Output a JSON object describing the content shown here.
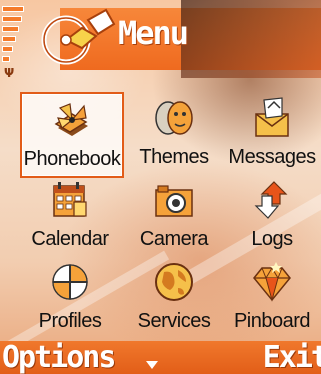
{
  "header": {
    "title": "Menu"
  },
  "grid": [
    {
      "label": "Phonebook",
      "icon": "phonebook-icon",
      "selected": true
    },
    {
      "label": "Themes",
      "icon": "themes-icon"
    },
    {
      "label": "Messages",
      "icon": "messages-icon"
    },
    {
      "label": "Calendar",
      "icon": "calendar-icon"
    },
    {
      "label": "Camera",
      "icon": "camera-icon"
    },
    {
      "label": "Logs",
      "icon": "logs-icon"
    },
    {
      "label": "Profiles",
      "icon": "profiles-icon"
    },
    {
      "label": "Services",
      "icon": "services-icon"
    },
    {
      "label": "Pinboard",
      "icon": "pinboard-icon"
    }
  ],
  "softkeys": {
    "left": "Options",
    "right": "Exit"
  },
  "colors": {
    "accent": "#ef6a1f",
    "selection": "#e25c18"
  }
}
